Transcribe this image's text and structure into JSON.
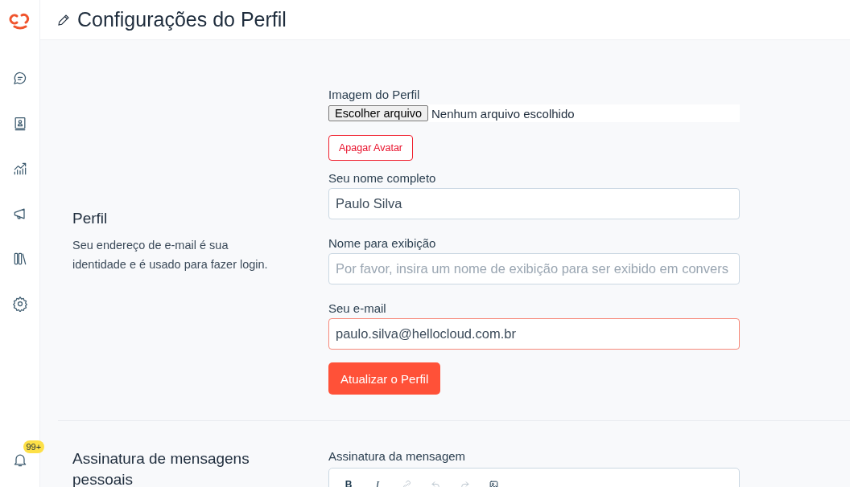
{
  "header": {
    "title": "Configurações do Perfil"
  },
  "sidebar": {
    "items": [
      {
        "kind": "chat"
      },
      {
        "kind": "contacts"
      },
      {
        "kind": "reports"
      },
      {
        "kind": "campaigns"
      },
      {
        "kind": "library"
      },
      {
        "kind": "settings"
      }
    ],
    "notifications": {
      "badge": "99+"
    }
  },
  "profile_section": {
    "title": "Perfil",
    "description": "Seu endereço de e-mail é sua identidade e é usado para fazer login.",
    "avatar": {
      "label": "Imagem do Perfil",
      "choose_button": "Escolher arquivo",
      "file_status": "Nenhum arquivo escolhido",
      "delete_button": "Apagar Avatar"
    },
    "fields": [
      {
        "label": "Seu nome completo",
        "value": "Paulo Silva",
        "focused": false
      },
      {
        "label": "Nome para exibição",
        "placeholder": "Por favor, insira um nome de exibição para ser exibido em convers",
        "focused": false
      },
      {
        "label": "Seu e-mail",
        "value": "paulo.silva@hellocloud.com.br",
        "focused": true
      }
    ],
    "submit_button": "Atualizar o Perfil"
  },
  "signature_section": {
    "title": "Assinatura de mensagens pessoais",
    "editor_label": "Assinatura da mensagem",
    "toolbar": [
      {
        "kind": "bold",
        "label": "B",
        "disabled": false
      },
      {
        "kind": "italic",
        "label": "I",
        "disabled": false
      },
      {
        "kind": "link",
        "disabled": true
      },
      {
        "kind": "undo",
        "disabled": true
      },
      {
        "kind": "redo",
        "disabled": true
      },
      {
        "kind": "image",
        "disabled": false
      }
    ]
  }
}
